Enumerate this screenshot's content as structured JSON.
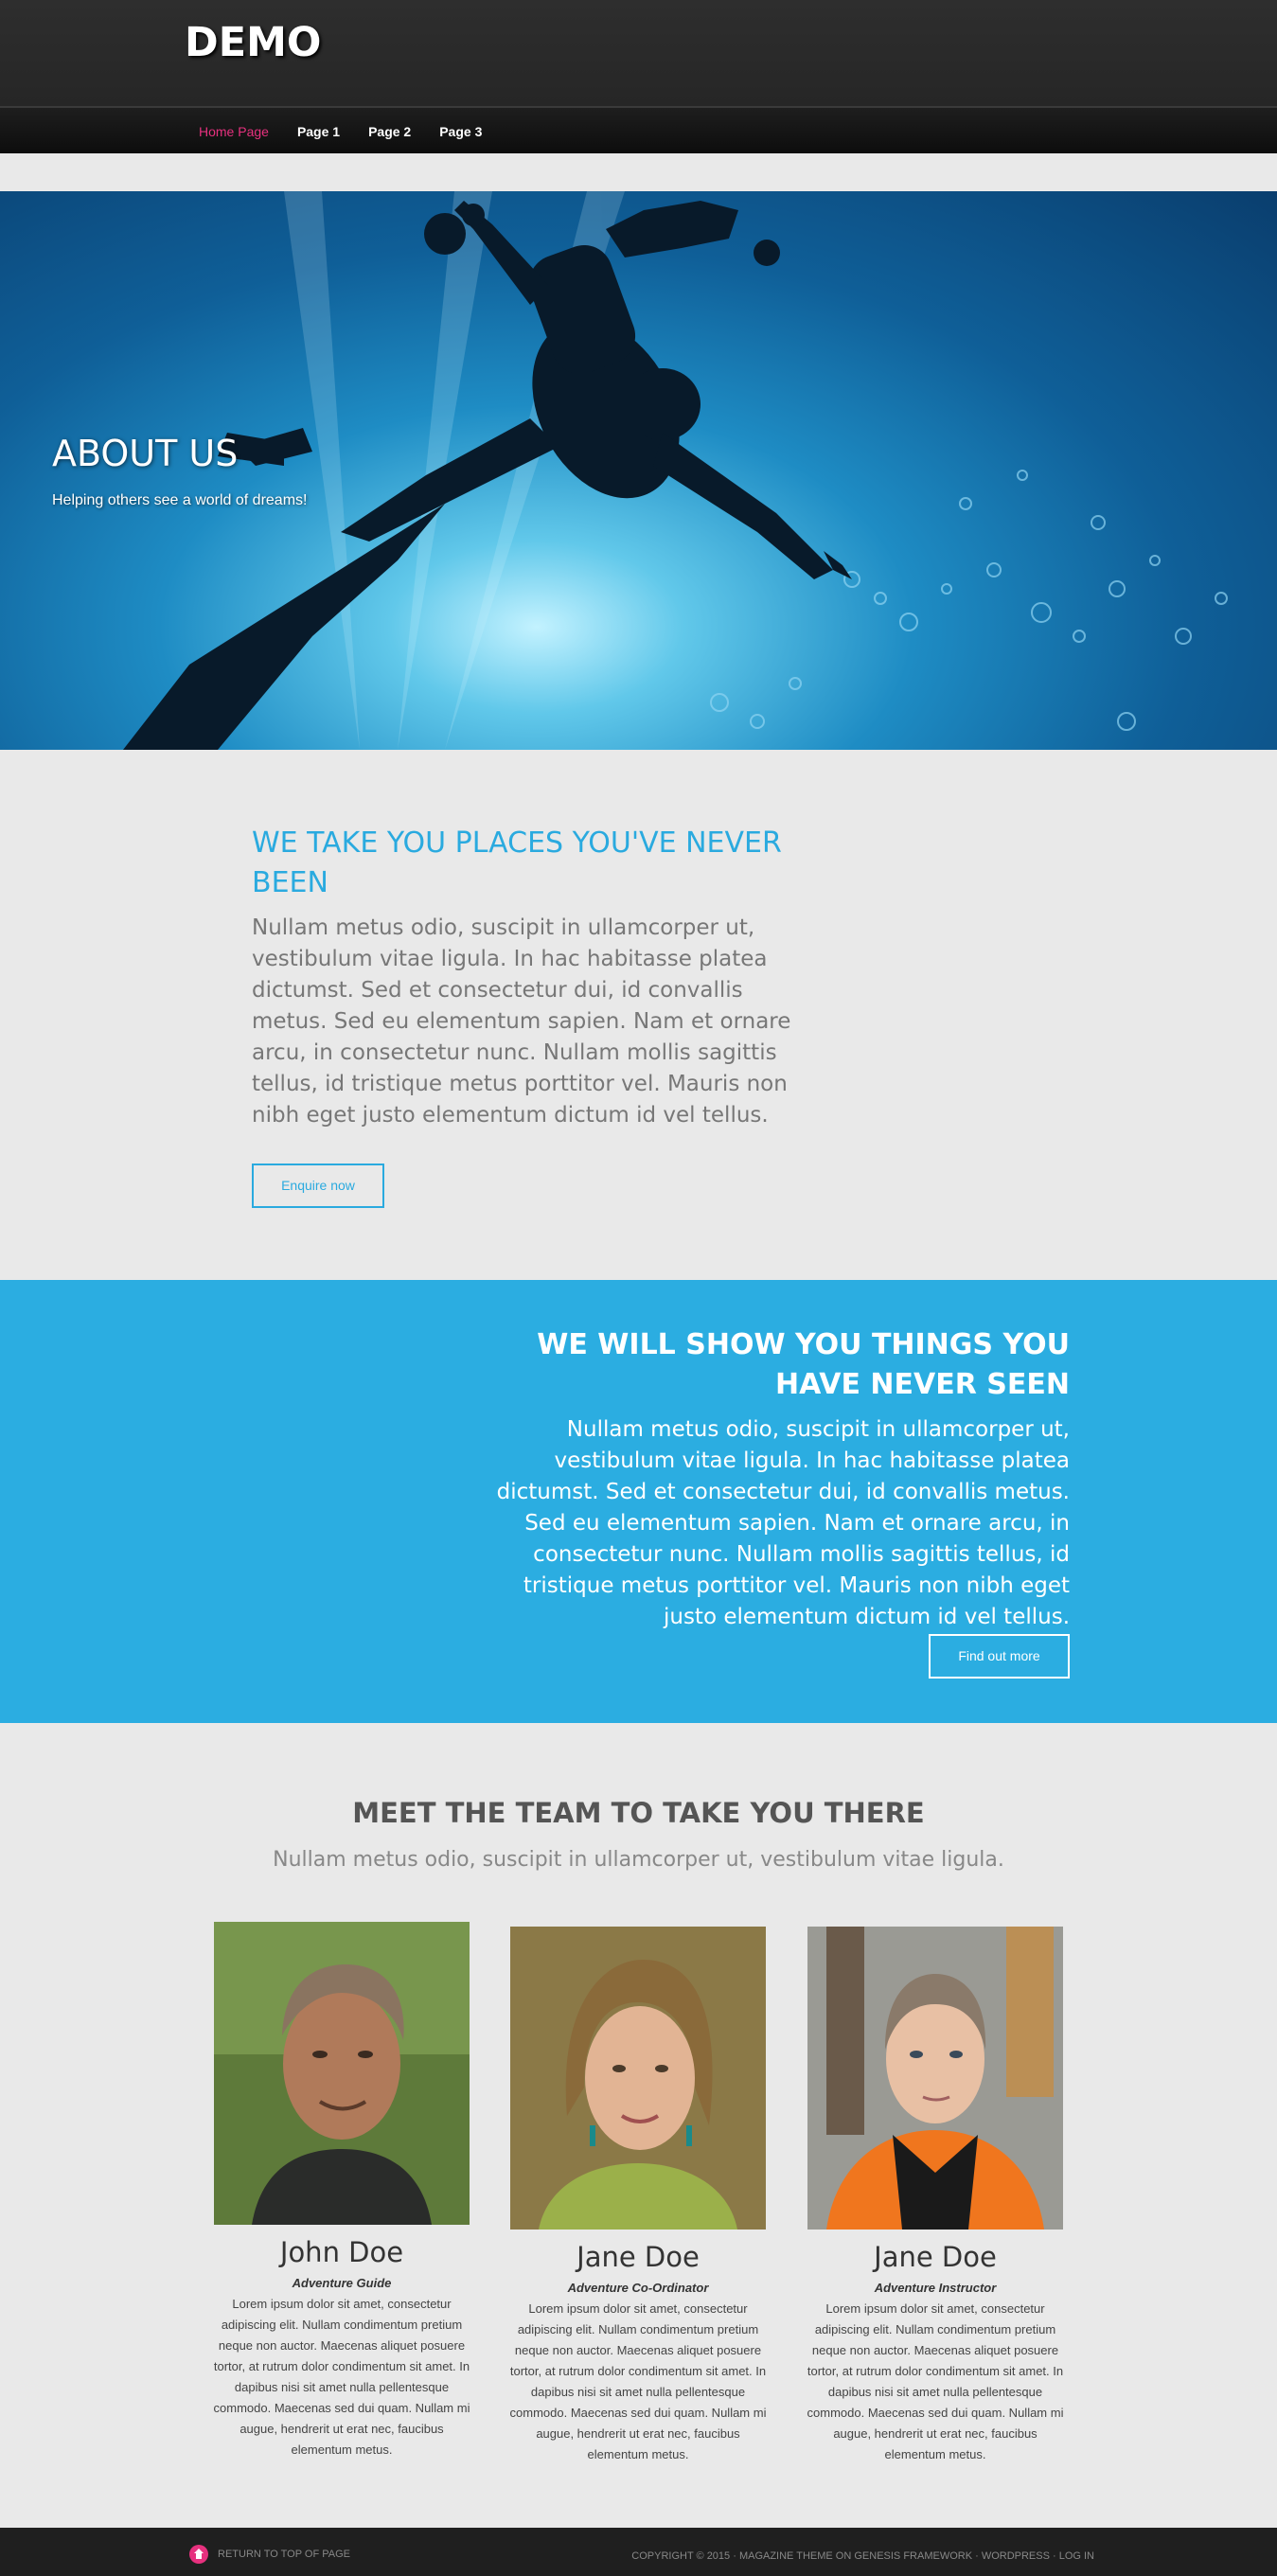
{
  "header": {
    "site_title": "DEMO"
  },
  "nav": {
    "items": [
      {
        "label": "Home Page",
        "active": true
      },
      {
        "label": "Page 1"
      },
      {
        "label": "Page 2"
      },
      {
        "label": "Page 3"
      }
    ]
  },
  "hero": {
    "title": "ABOUT US",
    "subtitle": "Helping others see a world of dreams!"
  },
  "section1": {
    "title": "WE TAKE YOU PLACES YOU'VE NEVER BEEN",
    "text": "Nullam metus odio, suscipit in ullamcorper ut, vestibulum vitae ligula. In hac habitasse platea dictumst. Sed et consectetur dui, id convallis metus. Sed eu elementum sapien. Nam et ornare arcu, in consectetur nunc. Nullam mollis sagittis tellus, id tristique metus porttitor vel. Mauris non nibh eget justo elementum dictum id vel tellus.",
    "button": "Enquire now"
  },
  "section2": {
    "title": "WE WILL SHOW YOU THINGS YOU HAVE NEVER SEEN",
    "text": "Nullam metus odio, suscipit in ullamcorper ut, vestibulum vitae ligula. In hac habitasse platea dictumst. Sed et consectetur dui, id convallis metus. Sed eu elementum sapien. Nam et ornare arcu, in consectetur nunc. Nullam mollis sagittis tellus, id tristique metus porttitor vel. Mauris non nibh eget justo elementum dictum id vel tellus.",
    "button": "Find out more"
  },
  "team": {
    "title": "MEET THE TEAM TO TAKE YOU THERE",
    "subtitle": "Nullam metus odio, suscipit in ullamcorper ut, vestibulum vitae ligula.",
    "members": [
      {
        "name": "John Doe",
        "role": "Adventure Guide",
        "bio": "Lorem ipsum dolor sit amet, consectetur adipiscing elit. Nullam condimentum pretium neque non auctor. Maecenas aliquet posuere tortor, at rutrum dolor condimentum sit amet. In dapibus nisi sit amet nulla pellentesque commodo. Maecenas sed dui quam. Nullam mi augue, hendrerit ut erat nec, faucibus elementum metus."
      },
      {
        "name": "Jane Doe",
        "role": "Adventure Co-Ordinator",
        "bio": "Lorem ipsum dolor sit amet, consectetur adipiscing elit. Nullam condimentum pretium neque non auctor. Maecenas aliquet posuere tortor, at rutrum dolor condimentum sit amet. In dapibus nisi sit amet nulla pellentesque commodo. Maecenas sed dui quam. Nullam mi augue, hendrerit ut erat nec, faucibus elementum metus."
      },
      {
        "name": "Jane Doe",
        "role": "Adventure Instructor",
        "bio": "Lorem ipsum dolor sit amet, consectetur adipiscing elit. Nullam condimentum pretium neque non auctor. Maecenas aliquet posuere tortor, at rutrum dolor condimentum sit amet. In dapibus nisi sit amet nulla pellentesque commodo. Maecenas sed dui quam. Nullam mi augue, hendrerit ut erat nec, faucibus elementum metus."
      }
    ]
  },
  "footer": {
    "return_label": "RETURN TO TOP OF PAGE",
    "copyright": "COPYRIGHT © 2015 · MAGAZINE THEME ON GENESIS FRAMEWORK · WORDPRESS · LOG IN"
  },
  "colors": {
    "accent_blue": "#2aaadf",
    "nav_active": "#e6317e",
    "header_bg": "#2b2b2b"
  }
}
